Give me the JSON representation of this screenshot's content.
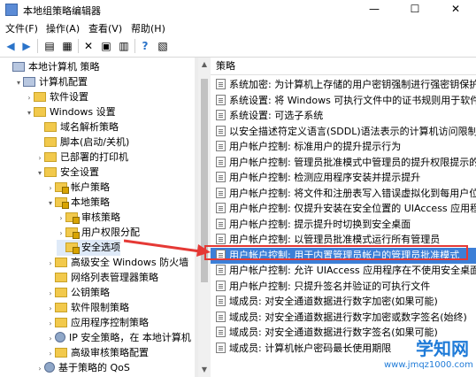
{
  "window": {
    "title": "本地组策略编辑器"
  },
  "menu": [
    "文件(F)",
    "操作(A)",
    "查看(V)",
    "帮助(H)"
  ],
  "tree": [
    {
      "label": "本地计算机 策略",
      "indent": 0,
      "icon": "computer",
      "expander": "",
      "selected": false
    },
    {
      "label": "计算机配置",
      "indent": 1,
      "icon": "computer",
      "expander": "▾",
      "selected": false
    },
    {
      "label": "软件设置",
      "indent": 2,
      "icon": "folder",
      "expander": "›",
      "selected": false
    },
    {
      "label": "Windows 设置",
      "indent": 2,
      "icon": "folder",
      "expander": "▾",
      "selected": false
    },
    {
      "label": "域名解析策略",
      "indent": 3,
      "icon": "folder",
      "expander": "",
      "selected": false
    },
    {
      "label": "脚本(启动/关机)",
      "indent": 3,
      "icon": "folder",
      "expander": "",
      "selected": false
    },
    {
      "label": "已部署的打印机",
      "indent": 3,
      "icon": "folder",
      "expander": "›",
      "selected": false
    },
    {
      "label": "安全设置",
      "indent": 3,
      "icon": "folder",
      "expander": "▾",
      "selected": false
    },
    {
      "label": "帐户策略",
      "indent": 4,
      "icon": "folder-lock",
      "expander": "›",
      "selected": false
    },
    {
      "label": "本地策略",
      "indent": 4,
      "icon": "folder-lock",
      "expander": "▾",
      "selected": false
    },
    {
      "label": "审核策略",
      "indent": 5,
      "icon": "folder-lock",
      "expander": "›",
      "selected": false
    },
    {
      "label": "用户权限分配",
      "indent": 5,
      "icon": "folder-lock",
      "expander": "›",
      "selected": false
    },
    {
      "label": "安全选项",
      "indent": 5,
      "icon": "folder-lock",
      "expander": "",
      "selected": true
    },
    {
      "label": "高级安全 Windows 防火墙",
      "indent": 4,
      "icon": "folder",
      "expander": "›",
      "selected": false
    },
    {
      "label": "网络列表管理器策略",
      "indent": 4,
      "icon": "folder",
      "expander": "",
      "selected": false
    },
    {
      "label": "公钥策略",
      "indent": 4,
      "icon": "folder",
      "expander": "›",
      "selected": false
    },
    {
      "label": "软件限制策略",
      "indent": 4,
      "icon": "folder",
      "expander": "›",
      "selected": false
    },
    {
      "label": "应用程序控制策略",
      "indent": 4,
      "icon": "folder",
      "expander": "›",
      "selected": false
    },
    {
      "label": "IP 安全策略，在 本地计算机",
      "indent": 4,
      "icon": "gear",
      "expander": "›",
      "selected": false
    },
    {
      "label": "高级审核策略配置",
      "indent": 4,
      "icon": "folder",
      "expander": "›",
      "selected": false
    },
    {
      "label": "基于策略的 QoS",
      "indent": 3,
      "icon": "gear",
      "expander": "›",
      "selected": false
    }
  ],
  "policy_header": "策略",
  "policies": [
    {
      "text": "系统加密: 为计算机上存储的用户密钥强制进行强密钥保护",
      "hl": false
    },
    {
      "text": "系统设置: 将 Windows 可执行文件中的证书规则用于软件...",
      "hl": false
    },
    {
      "text": "系统设置: 可选子系统",
      "hl": false
    },
    {
      "text": "以安全描述符定义语言(SDDL)语法表示的计算机访问限制",
      "hl": false
    },
    {
      "text": "用户帐户控制: 标准用户的提升提示行为",
      "hl": false
    },
    {
      "text": "用户帐户控制: 管理员批准模式中管理员的提升权限提示的...",
      "hl": false
    },
    {
      "text": "用户帐户控制: 检测应用程序安装并提示提升",
      "hl": false
    },
    {
      "text": "用户帐户控制: 将文件和注册表写入错误虚拟化到每用户位置",
      "hl": false
    },
    {
      "text": "用户帐户控制: 仅提升安装在安全位置的 UIAccess 应用程序",
      "hl": false
    },
    {
      "text": "用户帐户控制: 提示提升时切换到安全桌面",
      "hl": false
    },
    {
      "text": "用户帐户控制: 以管理员批准模式运行所有管理员",
      "hl": false
    },
    {
      "text": "用户帐户控制: 用于内置管理员帐户的管理员批准模式",
      "hl": true
    },
    {
      "text": "用户帐户控制: 允许 UIAccess 应用程序在不使用安全桌面...",
      "hl": false
    },
    {
      "text": "用户帐户控制: 只提升签名并验证的可执行文件",
      "hl": false
    },
    {
      "text": "域成员: 对安全通道数据进行数字加密(如果可能)",
      "hl": false
    },
    {
      "text": "域成员: 对安全通道数据进行数字加密或数字签名(始终)",
      "hl": false
    },
    {
      "text": "域成员: 对安全通道数据进行数字签名(如果可能)",
      "hl": false
    },
    {
      "text": "域成员: 计算机帐户密码最长使用期限",
      "hl": false
    }
  ],
  "watermark": {
    "big": "学知网",
    "small": "www.jmqz1000.com"
  }
}
